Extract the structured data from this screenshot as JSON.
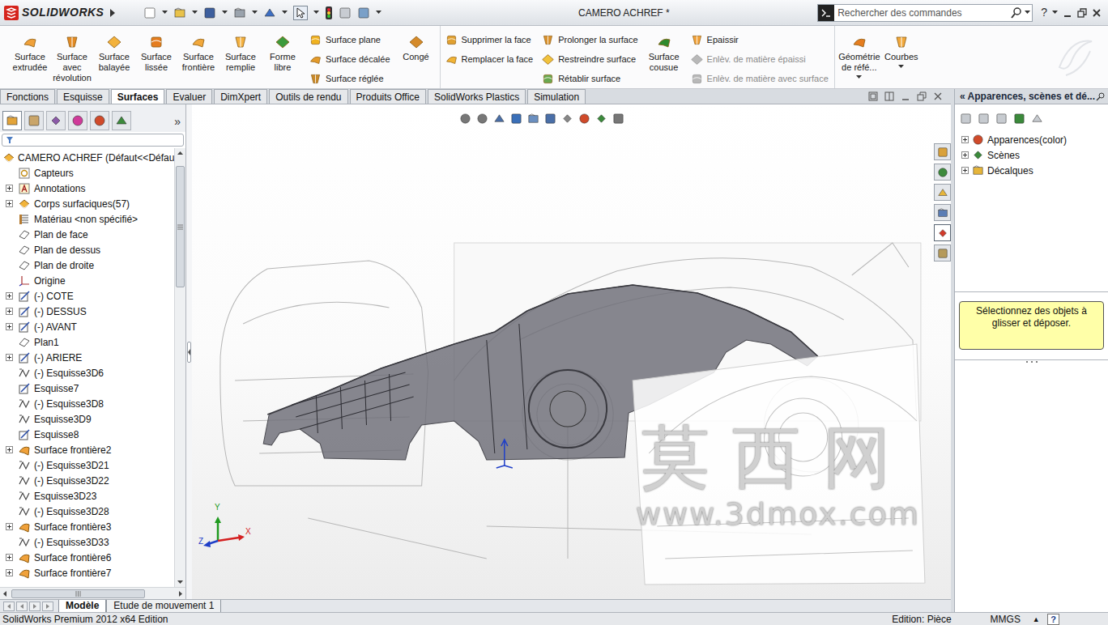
{
  "window": {
    "app": "SOLIDWORKS",
    "title": "CAMERO ACHREF *",
    "search_placeholder": "Rechercher des commandes",
    "help": "?"
  },
  "ribbon": {
    "groups": [
      {
        "kind": "large",
        "items": [
          {
            "label": "Surface extrudée",
            "disabled": false,
            "dropdown": false
          },
          {
            "label": "Surface avec révolution",
            "disabled": false,
            "dropdown": false
          },
          {
            "label": "Surface balayée",
            "disabled": false,
            "dropdown": false
          },
          {
            "label": "Surface lissée",
            "disabled": false,
            "dropdown": false
          },
          {
            "label": "Surface frontière",
            "disabled": false,
            "dropdown": false
          },
          {
            "label": "Surface remplie",
            "disabled": false,
            "dropdown": false
          },
          {
            "label": "Forme libre",
            "disabled": false,
            "dropdown": false
          }
        ]
      },
      {
        "kind": "stack",
        "items": [
          {
            "label": "Surface plane",
            "disabled": false
          },
          {
            "label": "Surface décalée",
            "disabled": false
          },
          {
            "label": "Surface réglée",
            "disabled": false
          }
        ]
      },
      {
        "kind": "large",
        "items": [
          {
            "label": "Congé",
            "disabled": false,
            "dropdown": false
          }
        ]
      },
      {
        "kind": "stack",
        "items": [
          {
            "label": "Supprimer la face",
            "disabled": false
          },
          {
            "label": "Remplacer la face",
            "disabled": false
          }
        ]
      },
      {
        "kind": "stack",
        "items": [
          {
            "label": "Prolonger la surface",
            "disabled": false
          },
          {
            "label": "Restreindre surface",
            "disabled": false
          },
          {
            "label": "Rétablir surface",
            "disabled": false
          }
        ]
      },
      {
        "kind": "large",
        "items": [
          {
            "label": "Surface cousue",
            "disabled": false,
            "dropdown": false
          }
        ]
      },
      {
        "kind": "stack",
        "items": [
          {
            "label": "Epaissir",
            "disabled": false
          },
          {
            "label": "Enlèv. de matière épaissi",
            "disabled": true
          },
          {
            "label": "Enlèv. de matière avec surface",
            "disabled": true
          }
        ]
      },
      {
        "kind": "large",
        "items": [
          {
            "label": "Géométrie de réfé...",
            "disabled": false,
            "dropdown": true
          },
          {
            "label": "Courbes",
            "disabled": false,
            "dropdown": true
          }
        ]
      }
    ]
  },
  "tabs": [
    {
      "label": "Fonctions",
      "selected": false
    },
    {
      "label": "Esquisse",
      "selected": false
    },
    {
      "label": "Surfaces",
      "selected": true
    },
    {
      "label": "Evaluer",
      "selected": false
    },
    {
      "label": "DimXpert",
      "selected": false
    },
    {
      "label": "Outils de rendu",
      "selected": false
    },
    {
      "label": "Produits Office",
      "selected": false
    },
    {
      "label": "SolidWorks Plastics",
      "selected": false
    },
    {
      "label": "Simulation",
      "selected": false
    }
  ],
  "feature_manager": {
    "panel_tabs": [
      {
        "selected": true
      },
      {
        "selected": false
      },
      {
        "selected": false
      },
      {
        "selected": false
      },
      {
        "selected": false
      },
      {
        "selected": false
      }
    ],
    "more": "»",
    "root": "CAMERO ACHREF (Défaut<<Défau",
    "items": [
      {
        "label": "Capteurs",
        "kind": "sensor",
        "expandable": false,
        "expanded": false
      },
      {
        "label": "Annotations",
        "kind": "annotation",
        "expandable": true,
        "expanded": false
      },
      {
        "label": "Corps surfaciques(57)",
        "kind": "body",
        "expandable": true,
        "expanded": false
      },
      {
        "label": "Matériau <non spécifié>",
        "kind": "material",
        "expandable": false,
        "expanded": false
      },
      {
        "label": "Plan de face",
        "kind": "plane",
        "expandable": false,
        "expanded": false
      },
      {
        "label": "Plan de dessus",
        "kind": "plane",
        "expandable": false,
        "expanded": false
      },
      {
        "label": "Plan de droite",
        "kind": "plane",
        "expandable": false,
        "expanded": false
      },
      {
        "label": "Origine",
        "kind": "origin",
        "expandable": false,
        "expanded": false
      },
      {
        "label": "(-) COTE",
        "kind": "sketch",
        "expandable": true,
        "expanded": false
      },
      {
        "label": "(-) DESSUS",
        "kind": "sketch",
        "expandable": true,
        "expanded": false
      },
      {
        "label": "(-) AVANT",
        "kind": "sketch",
        "expandable": true,
        "expanded": false
      },
      {
        "label": "Plan1",
        "kind": "plane",
        "expandable": false,
        "expanded": false
      },
      {
        "label": "(-) ARIERE",
        "kind": "sketch",
        "expandable": true,
        "expanded": false
      },
      {
        "label": "(-) Esquisse3D6",
        "kind": "sketch3d",
        "expandable": false,
        "expanded": false
      },
      {
        "label": "Esquisse7",
        "kind": "sketch",
        "expandable": false,
        "expanded": false
      },
      {
        "label": "(-) Esquisse3D8",
        "kind": "sketch3d",
        "expandable": false,
        "expanded": false
      },
      {
        "label": "Esquisse3D9",
        "kind": "sketch3d",
        "expandable": false,
        "expanded": false
      },
      {
        "label": "Esquisse8",
        "kind": "sketch",
        "expandable": false,
        "expanded": false
      },
      {
        "label": "Surface frontière2",
        "kind": "surface",
        "expandable": true,
        "expanded": false
      },
      {
        "label": "(-) Esquisse3D21",
        "kind": "sketch3d",
        "expandable": false,
        "expanded": false
      },
      {
        "label": "(-) Esquisse3D22",
        "kind": "sketch3d",
        "expandable": false,
        "expanded": false
      },
      {
        "label": "Esquisse3D23",
        "kind": "sketch3d",
        "expandable": false,
        "expanded": false
      },
      {
        "label": "(-) Esquisse3D28",
        "kind": "sketch3d",
        "expandable": false,
        "expanded": false
      },
      {
        "label": "Surface frontière3",
        "kind": "surface",
        "expandable": true,
        "expanded": false
      },
      {
        "label": "(-) Esquisse3D33",
        "kind": "sketch3d",
        "expandable": false,
        "expanded": false
      },
      {
        "label": "Surface frontière6",
        "kind": "surface",
        "expandable": true,
        "expanded": false
      },
      {
        "label": "Surface frontière7",
        "kind": "surface",
        "expandable": true,
        "expanded": false
      }
    ]
  },
  "viewport": {
    "task_tabs": [
      {
        "selected": false
      },
      {
        "selected": false
      },
      {
        "selected": false
      },
      {
        "selected": false
      },
      {
        "selected": true
      },
      {
        "selected": false
      }
    ],
    "triad": [
      {
        "label": "Y",
        "color": "#1f9a1f"
      },
      {
        "label": "Z",
        "color": "#1f3fc8"
      },
      {
        "label": "X",
        "color": "#d42020"
      }
    ],
    "watermark": {
      "text": "莫西网",
      "url": "www.3dmox.com"
    }
  },
  "task_pane": {
    "title": "« Apparences, scènes et dé...",
    "items": [
      {
        "label": "Apparences(color)",
        "expanded": false
      },
      {
        "label": "Scènes",
        "expanded": false
      },
      {
        "label": "Décalques",
        "expanded": false
      }
    ],
    "hint": "Sélectionnez des objets à glisser et déposer."
  },
  "bottom_tabs": [
    {
      "label": "Modèle",
      "selected": true
    },
    {
      "label": "Etude de mouvement 1",
      "selected": false
    }
  ],
  "status_bar": {
    "product": "SolidWorks Premium 2012 x64 Edition",
    "mode": "Edition: Pièce",
    "units": "MMGS",
    "units_arrow": "▲",
    "help": "?"
  }
}
